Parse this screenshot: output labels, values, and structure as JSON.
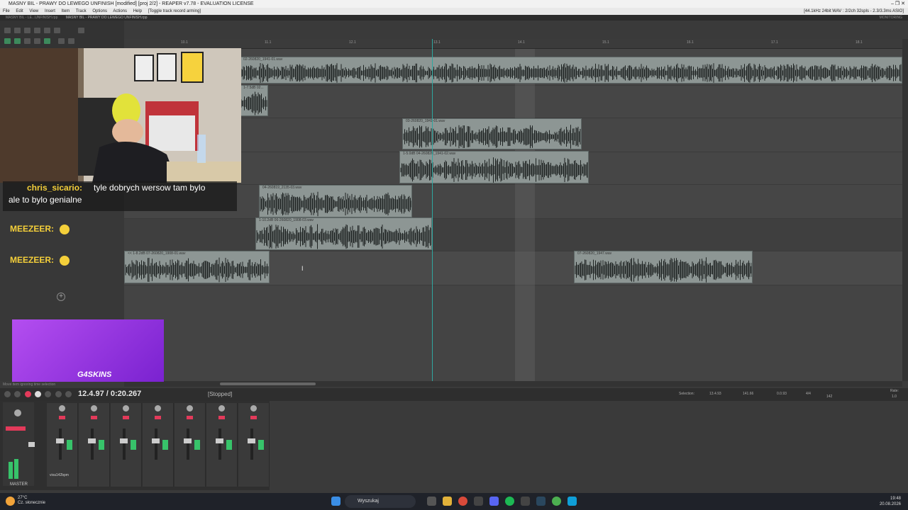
{
  "window": {
    "title": "MASNY BIL - PRAWY DO LEWEGO UNFINISH [modified] [proj 2/2] - REAPER v7.78 - EVALUATION LICENSE",
    "controls": "–  ❐  ✕"
  },
  "menubar": {
    "items": [
      "File",
      "Edit",
      "View",
      "Insert",
      "Item",
      "Track",
      "Options",
      "Actions",
      "Help"
    ],
    "hint": "[Toggle track record arming]",
    "audio_info": "[44.1kHz 24bit WAV : 2/2ch 32spls - 2.3/3.3ms ASIO]"
  },
  "tabbar": {
    "tabs": [
      "MASNY BIL - LE...UNFINISH.rpp",
      "MASNY BIL - PRAWY DO LEWEGO UNFINISH.rpp"
    ],
    "right": "MONITORING"
  },
  "ruler": {
    "ticks": [
      "10.1",
      "11.1",
      "12.1",
      "13.1",
      "14.1",
      "15.1",
      "16.1",
      "17.1",
      "18.1"
    ]
  },
  "items": [
    {
      "name": "02-260820_1941-01.wav"
    },
    {
      "name": "1-7.5dB 02..."
    },
    {
      "name": "03-260820_1941-01.wav"
    },
    {
      "name": "1-5.0dB 04-260820_1941-02.wav"
    },
    {
      "name": "04-260819_2135-03.wav"
    },
    {
      "name": "1-10.2dB 06-260820_1908-03.wav"
    },
    {
      "name": "<< 1-8.2dB 07-260820_1908-01.wav"
    },
    {
      "name": "07-260820_1947.wav"
    }
  ],
  "chat": {
    "user": "chris_sicario:",
    "line1": "tyle dobrych wersow tam bylo",
    "line2": "ale to bylo genialne"
  },
  "badges": [
    "MEEZEER:",
    "MEEZEER:"
  ],
  "promo": {
    "brand": "G4SKINS"
  },
  "transport": {
    "time": "12.4.97 / 0:20.267",
    "status": "[Stopped]",
    "hint": "Move item ignoring time selection"
  },
  "selection": {
    "label": "Selection:",
    "start": "13.4.93",
    "end": "141.66",
    "length": "0.0.93",
    "timesig": "4/4",
    "bpm": "142",
    "rate_label": "Rate:",
    "rate": "1.0"
  },
  "mixer": {
    "master_label": "MASTER",
    "track_name": "vixa142bpm",
    "db_red": "+6.0"
  },
  "taskbar": {
    "temp": "27°C",
    "weather": "Cz. słonecznie",
    "search": "Wyszukaj",
    "time": "19:48",
    "date": "20.08.2026"
  },
  "colors": {
    "playhead": "#2fa7a0",
    "item": "#8d9694",
    "chat_user": "#f4cf3a",
    "promo": "#9b3fe6",
    "fx_green": "#37c36a",
    "rec_red": "#e33a5a"
  }
}
